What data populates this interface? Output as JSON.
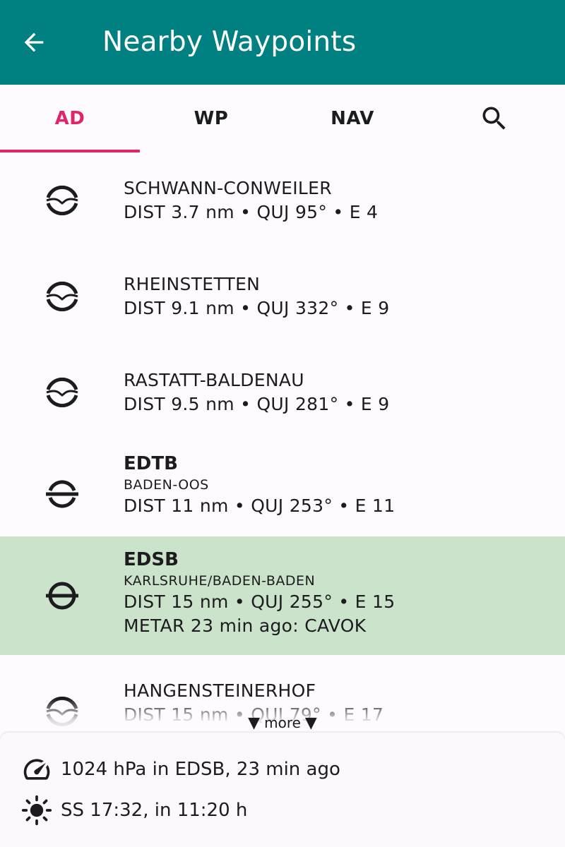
{
  "appbar": {
    "title": "Nearby Waypoints",
    "back_icon": "arrow-back-icon",
    "background": "#008080"
  },
  "tabs": {
    "items": [
      {
        "label": "AD",
        "active": true
      },
      {
        "label": "WP",
        "active": false
      },
      {
        "label": "NAV",
        "active": false
      }
    ],
    "search_icon": "search-icon",
    "accent_color": "#e0256b"
  },
  "waypoints": [
    {
      "icon": "airfield-glider-icon",
      "name": "SCHWANN-CONWEILER",
      "info": "DIST 3.7 nm • QUJ 95° • E 4"
    },
    {
      "icon": "airfield-glider-icon",
      "name": "RHEINSTETTEN",
      "info": "DIST 9.1 nm • QUJ 332° • E 9"
    },
    {
      "icon": "airfield-glider-icon",
      "name": "RASTATT-BALDENAU",
      "info": "DIST 9.5 nm • QUJ 281° • E 9"
    },
    {
      "icon": "airfield-civil-icon",
      "code": "EDTB",
      "name": "BADEN-OOS",
      "info": "DIST 11 nm • QUJ 253° • E 11"
    },
    {
      "icon": "airport-icon",
      "code": "EDSB",
      "name": "KARLSRUHE/BADEN-BADEN",
      "info": "DIST 15 nm • QUJ 255° • E 15",
      "metar": "METAR 23 min ago: CAVOK",
      "selected": true,
      "highlight_color": "#cce3cb"
    },
    {
      "icon": "airfield-glider-icon",
      "name": "HANGENSTEINERHOF",
      "info": "DIST 15 nm • QUJ 79° • E 17"
    }
  ],
  "more": {
    "label": "more"
  },
  "info_panel": {
    "pressure": {
      "icon": "gauge-icon",
      "text": "1024 hPa in EDSB, 23 min ago"
    },
    "sunset": {
      "icon": "sun-icon",
      "text": "SS 17:32, in 11:20 h"
    }
  }
}
